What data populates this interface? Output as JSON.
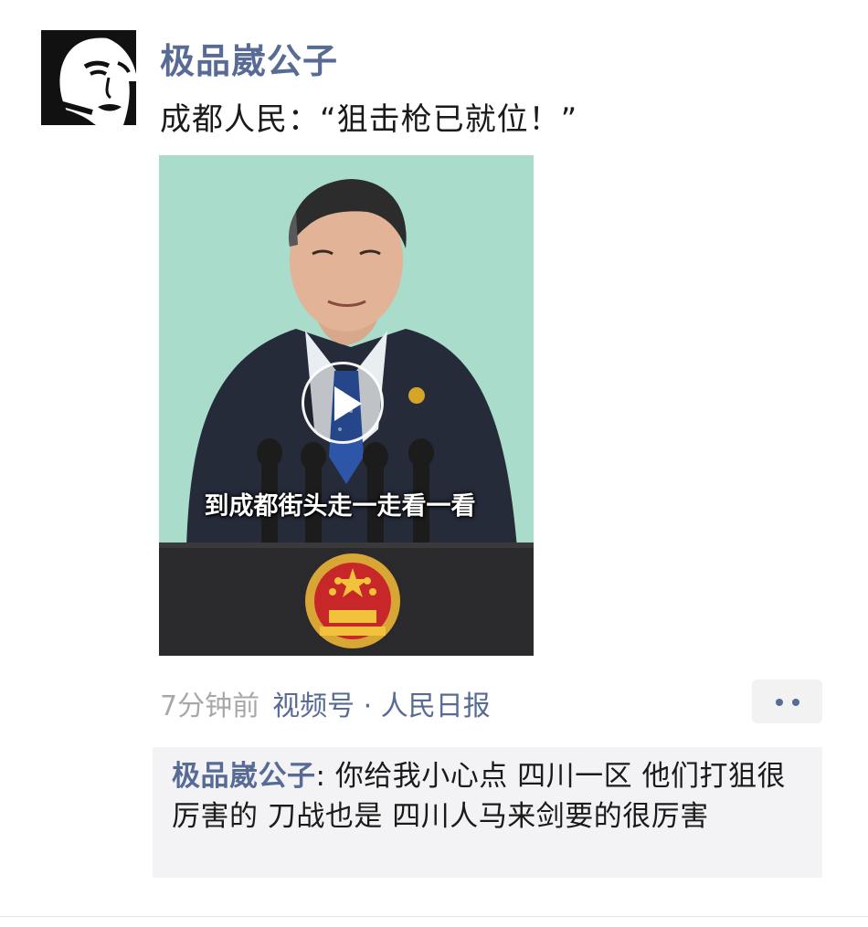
{
  "post": {
    "username": "极品崴公子",
    "text": "成都人民：“狙击枪已就位！”",
    "video": {
      "subtitle": "到成都街头走一走看一看",
      "background_color": "#a9dccb"
    },
    "meta": {
      "time": "7分钟前",
      "source": "视频号 · 人民日报"
    },
    "more_icon": "ellipsis-icon",
    "comments": [
      {
        "author": "极品崴公子",
        "separator": ": ",
        "text": "你给我小心点 四川一区 他们打狙很厉害的 刀战也是 四川人马来剑要的很厉害"
      }
    ]
  },
  "colors": {
    "link": "#576b95",
    "timestamp": "#a8a8a8",
    "comment_bg": "#f3f3f5"
  }
}
